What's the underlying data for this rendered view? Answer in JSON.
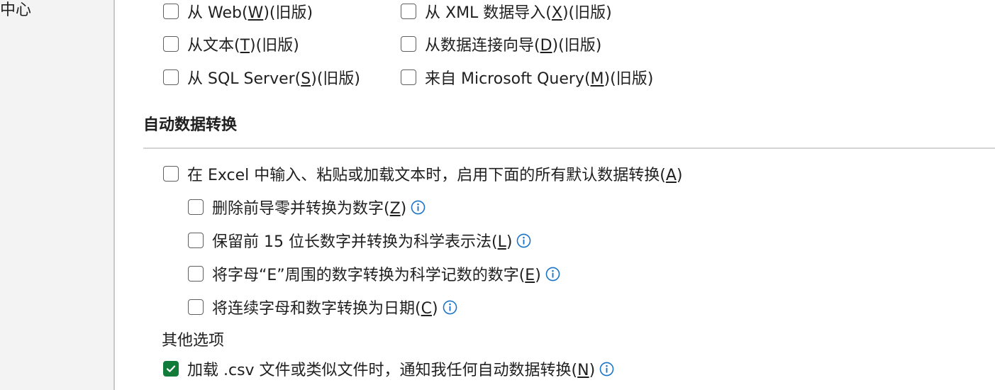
{
  "sidebar": {
    "item_partial": "中心"
  },
  "legacy_wizards": {
    "items": [
      {
        "pre": "从 Web(",
        "key": "W",
        "post": ")(旧版)",
        "checked": false
      },
      {
        "pre": "从 XML 数据导入(",
        "key": "X",
        "post": ")(旧版)",
        "checked": false
      },
      {
        "pre": "从文本(",
        "key": "T",
        "post": ")(旧版)",
        "checked": false
      },
      {
        "pre": "从数据连接向导(",
        "key": "D",
        "post": ")(旧版)",
        "checked": false
      },
      {
        "pre": "从 SQL Server(",
        "key": "S",
        "post": ")(旧版)",
        "checked": false
      },
      {
        "pre": "来自 Microsoft Query(",
        "key": "M",
        "post": ")(旧版)",
        "checked": false
      }
    ]
  },
  "auto_conversion": {
    "title": "自动数据转换",
    "main_option": {
      "pre": "在 Excel 中输入、粘贴或加载文本时，启用下面的所有默认数据转换(",
      "key": "A",
      "post": ")",
      "checked": false
    },
    "sub_options": [
      {
        "pre": "删除前导零并转换为数字(",
        "key": "Z",
        "post": ")",
        "checked": false
      },
      {
        "pre": "保留前 15 位长数字并转换为科学表示法(",
        "key": "L",
        "post": ")",
        "checked": false
      },
      {
        "pre": "将字母“E”周围的数字转换为科学记数的数字(",
        "key": "E",
        "post": ")",
        "checked": false
      },
      {
        "pre": "将连续字母和数字转换为日期(",
        "key": "C",
        "post": ")",
        "checked": false
      }
    ]
  },
  "other_options": {
    "heading": "其他选项",
    "notify_option": {
      "pre": "加载 .csv 文件或类似文件时，通知我任何自动数据转换(",
      "key": "N",
      "post": ")",
      "checked": true
    }
  },
  "colors": {
    "accent_check": "#117b3a",
    "info_icon": "#1a73c7"
  }
}
